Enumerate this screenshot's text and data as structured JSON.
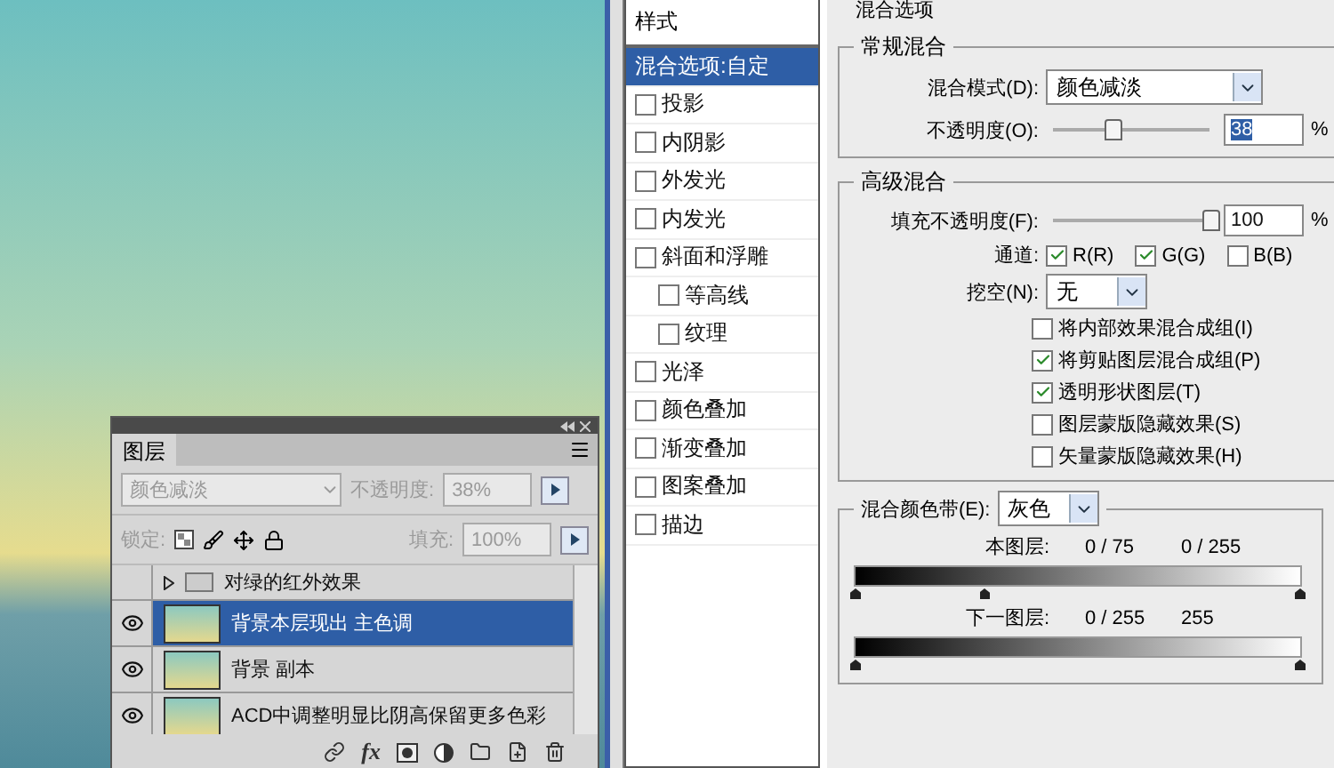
{
  "layers_panel": {
    "tab": "图层",
    "blend_mode": {
      "value": "颜色减淡",
      "disabled": true
    },
    "opacity": {
      "label": "不透明度:",
      "value": "38%",
      "disabled": true
    },
    "lock": {
      "label": "锁定:",
      "disabled": true
    },
    "fill": {
      "label": "填充:",
      "value": "100%",
      "disabled": true
    },
    "layers": [
      {
        "kind": "group",
        "name": "对绿的红外效果",
        "visible": false,
        "selected": false
      },
      {
        "kind": "layer",
        "name": "背景本层现出 主色调",
        "visible": true,
        "selected": true
      },
      {
        "kind": "layer",
        "name": "背景 副本",
        "visible": true,
        "selected": false
      },
      {
        "kind": "layer",
        "name": "ACD中调整明显比阴高保留更多色彩",
        "visible": true,
        "selected": false
      }
    ],
    "footer_fx": "fx"
  },
  "styles": {
    "header": "样式",
    "items": [
      {
        "kind": "option",
        "label": "混合选项:自定",
        "selected": true
      },
      {
        "kind": "check",
        "label": "投影",
        "checked": false,
        "selected": false
      },
      {
        "kind": "check",
        "label": "内阴影",
        "checked": false,
        "selected": false
      },
      {
        "kind": "check",
        "label": "外发光",
        "checked": false,
        "selected": false
      },
      {
        "kind": "check",
        "label": "内发光",
        "checked": false,
        "selected": false
      },
      {
        "kind": "check",
        "label": "斜面和浮雕",
        "checked": false,
        "selected": false,
        "children": [
          {
            "kind": "check",
            "label": "等高线",
            "checked": false,
            "selected": false
          },
          {
            "kind": "check",
            "label": "纹理",
            "checked": false,
            "selected": false
          }
        ]
      },
      {
        "kind": "check",
        "label": "光泽",
        "checked": false,
        "selected": false
      },
      {
        "kind": "check",
        "label": "颜色叠加",
        "checked": false,
        "selected": false
      },
      {
        "kind": "check",
        "label": "渐变叠加",
        "checked": false,
        "selected": false
      },
      {
        "kind": "check",
        "label": "图案叠加",
        "checked": false,
        "selected": false
      },
      {
        "kind": "check",
        "label": "描边",
        "checked": false,
        "selected": false
      }
    ]
  },
  "blend_options": {
    "title": "混合选项",
    "general": {
      "title": "常规混合",
      "mode": {
        "label": "混合模式(D):",
        "value": "颜色减淡"
      },
      "opacity": {
        "label": "不透明度(O):",
        "value": "38",
        "selected": true,
        "level": 0.38,
        "unit": "%"
      }
    },
    "advanced": {
      "title": "高级混合",
      "fill_opacity": {
        "label": "填充不透明度(F):",
        "value": "100",
        "selected": false,
        "level": 1,
        "unit": "%"
      },
      "channels": {
        "label": "通道:",
        "items": [
          {
            "label": "R(R)",
            "checked": true
          },
          {
            "label": "G(G)",
            "checked": true
          },
          {
            "label": "B(B)",
            "checked": false
          }
        ]
      },
      "knockout": {
        "label": "挖空(N):",
        "value": "无"
      },
      "options": [
        {
          "label": "将内部效果混合成组(I)",
          "checked": false
        },
        {
          "label": "将剪贴图层混合成组(P)",
          "checked": true
        },
        {
          "label": "透明形状图层(T)",
          "checked": true
        },
        {
          "label": "图层蒙版隐藏效果(S)",
          "checked": false
        },
        {
          "label": "矢量蒙版隐藏效果(H)",
          "checked": false
        }
      ]
    },
    "blend_if": {
      "label": "混合颜色带(E):",
      "value": "灰色",
      "bands": [
        {
          "label": "本图层:",
          "readings": [
            "0 / 75",
            "0 / 255"
          ],
          "thumbs": [
            {
              "level": 0
            },
            {
              "level": 0.29
            },
            {
              "level": 1
            }
          ]
        },
        {
          "label": "下一图层:",
          "readings": [
            "0 / 255",
            "255"
          ],
          "thumbs": [
            {
              "level": 0
            },
            {
              "level": 1
            }
          ]
        }
      ]
    }
  }
}
